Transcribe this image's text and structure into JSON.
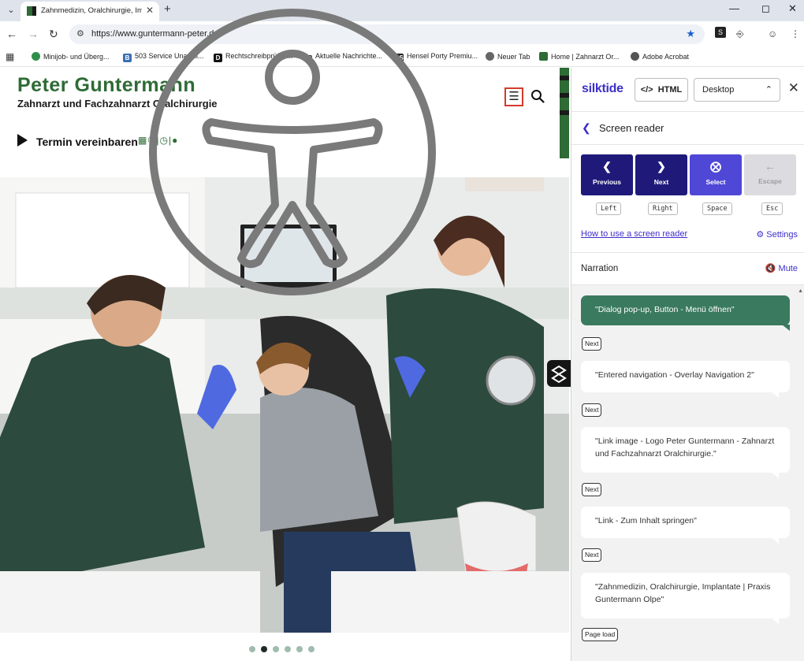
{
  "browser": {
    "tab_title": "Zahnmedizin, Oralchirurgie, Implantate | Praxis Guntermann Olpe",
    "url": "https://www.guntermann-peter.de",
    "bookmarks": [
      {
        "label": "Minijob- und Überg...",
        "color": "#2f8f4a"
      },
      {
        "label": "503 Service Unavail...",
        "color": "#3b6fb5"
      },
      {
        "label": "Rechtschreibprüfun...",
        "color": "#111111"
      },
      {
        "label": "Aktuelle Nachrichte...",
        "color": "#c8a300"
      },
      {
        "label": "Hensel Porty Premiu...",
        "color": "#222222"
      },
      {
        "label": "Neuer Tab",
        "color": "#666666"
      },
      {
        "label": "Home | Zahnarzt Or...",
        "color": "#2e6b35"
      },
      {
        "label": "Adobe Acrobat",
        "color": "#555555"
      }
    ]
  },
  "site": {
    "logo_name": "Peter Guntermann",
    "logo_subtitle": "Zahnarzt und Fachzahnarzt Oralchirurgie",
    "termin_label": "Termin vereinbaren",
    "accent": "#2e6b35"
  },
  "panel": {
    "brand": "silktide",
    "html_button": "HTML",
    "view_select": "Desktop",
    "section_title": "Screen reader",
    "controls": [
      {
        "label": "Previous",
        "key": "Left"
      },
      {
        "label": "Next",
        "key": "Right"
      },
      {
        "label": "Select",
        "key": "Space"
      },
      {
        "label": "Escape",
        "key": "Esc"
      }
    ],
    "howto_link": "How to use a screen reader",
    "settings_label": "Settings",
    "narration_title": "Narration",
    "mute_label": "Mute",
    "narration": [
      {
        "text": "\"Dialog pop-up, Button - Menü öffnen\"",
        "tag": "Next"
      },
      {
        "text": "\"Entered navigation - Overlay Navigation 2\"",
        "tag": "Next"
      },
      {
        "text": "\"Link image - Logo Peter Guntermann - Zahnarzt und Fachzahnarzt Oralchirurgie.\"",
        "tag": "Next"
      },
      {
        "text": "\"Link - Zum Inhalt springen\"",
        "tag": "Next"
      },
      {
        "text": "\"Zahnmedizin, Oralchirurgie, Implantate | Praxis Guntermann Olpe\"",
        "tag": "Page load"
      }
    ],
    "brand_color": "#3d2fc9"
  }
}
